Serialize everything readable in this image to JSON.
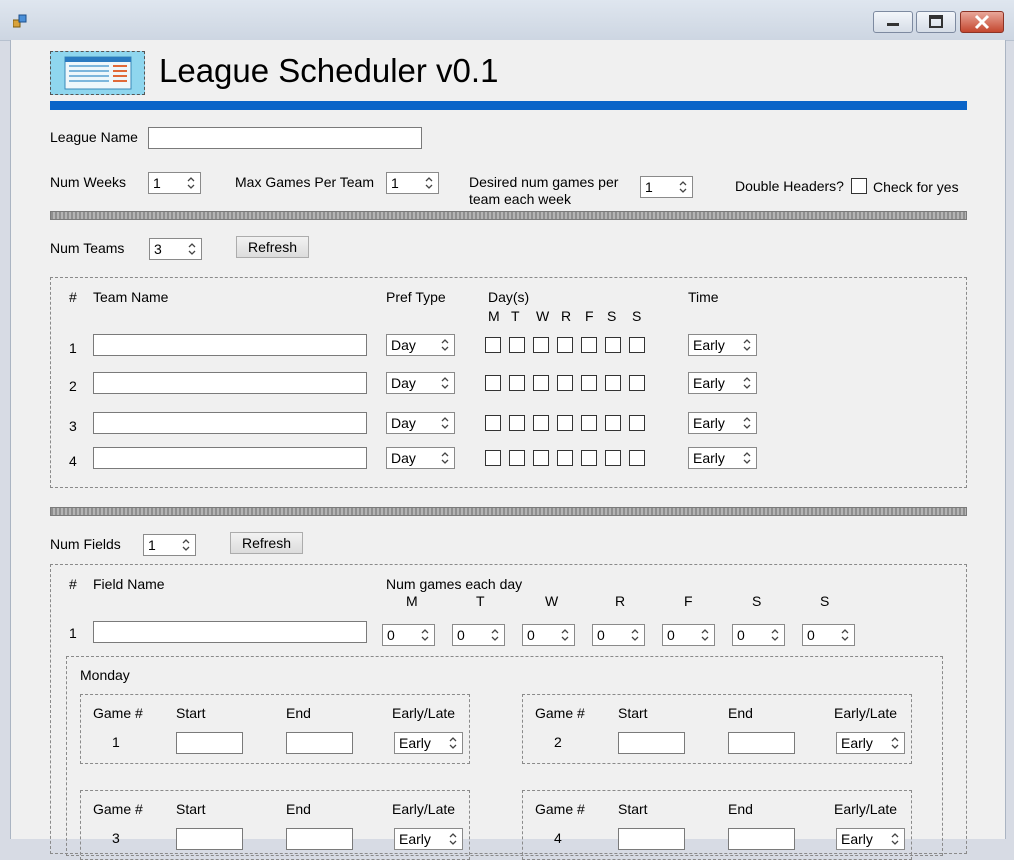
{
  "app": {
    "title": "League Scheduler v0.1"
  },
  "league": {
    "name_label": "League Name",
    "name_value": ""
  },
  "settings": {
    "num_weeks_label": "Num Weeks",
    "num_weeks": "1",
    "max_games_label": "Max Games Per Team",
    "max_games": "1",
    "desired_label_1": "Desired num games per",
    "desired_label_2": "team each week",
    "desired_games": "1",
    "double_headers_label": "Double Headers?",
    "check_for_yes": "Check for yes"
  },
  "teams": {
    "num_label": "Num Teams",
    "num_value": "3",
    "refresh": "Refresh",
    "headers": {
      "num": "#",
      "name": "Team Name",
      "pref": "Pref Type",
      "days": "Day(s)",
      "time": "Time"
    },
    "day_letters": [
      "M",
      "T",
      "W",
      "R",
      "F",
      "S",
      "S"
    ],
    "rows": [
      {
        "num": "1",
        "name": "",
        "pref": "Day",
        "time": "Early"
      },
      {
        "num": "2",
        "name": "",
        "pref": "Day",
        "time": "Early"
      },
      {
        "num": "3",
        "name": "",
        "pref": "Day",
        "time": "Early"
      },
      {
        "num": "4",
        "name": "",
        "pref": "Day",
        "time": "Early"
      }
    ]
  },
  "fields": {
    "num_label": "Num Fields",
    "num_value": "1",
    "refresh": "Refresh",
    "headers": {
      "num": "#",
      "name": "Field Name",
      "games_each_day": "Num games each day"
    },
    "day_letters": [
      "M",
      "T",
      "W",
      "R",
      "F",
      "S",
      "S"
    ],
    "rows": [
      {
        "num": "1",
        "name": "",
        "games": [
          "0",
          "0",
          "0",
          "0",
          "0",
          "0",
          "0"
        ]
      }
    ],
    "day_group": {
      "title": "Monday",
      "game_headers": {
        "game": "Game #",
        "start": "Start",
        "end": "End",
        "early_late": "Early/Late"
      },
      "games": [
        {
          "num": "1",
          "start": "",
          "end": "",
          "early_late": "Early"
        },
        {
          "num": "2",
          "start": "",
          "end": "",
          "early_late": "Early"
        },
        {
          "num": "3",
          "start": "",
          "end": "",
          "early_late": "Early"
        },
        {
          "num": "4",
          "start": "",
          "end": "",
          "early_late": "Early"
        }
      ]
    }
  }
}
